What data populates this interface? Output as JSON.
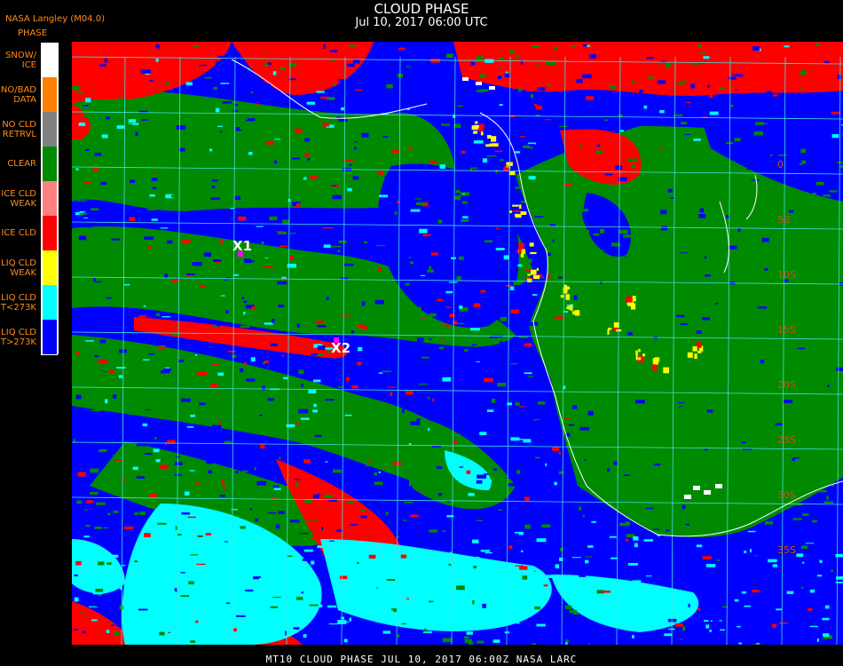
{
  "header": {
    "title": "CLOUD PHASE",
    "subtitle": "Jul 10, 2017 06:00 UTC",
    "producer": "NASA Langley (M04.0)",
    "legend_heading": "PHASE"
  },
  "legend": [
    {
      "lines": [
        "SNOW/",
        "ICE"
      ],
      "color": "#ffffff"
    },
    {
      "lines": [
        "NO/BAD",
        "DATA"
      ],
      "color": "#ff7f00"
    },
    {
      "lines": [
        "NO CLD",
        "RETRVL"
      ],
      "color": "#808080"
    },
    {
      "lines": [
        "CLEAR"
      ],
      "color": "#008a00"
    },
    {
      "lines": [
        "ICE CLD",
        "WEAK"
      ],
      "color": "#ff8080"
    },
    {
      "lines": [
        "ICE CLD"
      ],
      "color": "#ff0000"
    },
    {
      "lines": [
        "LIQ CLD",
        "WEAK"
      ],
      "color": "#ffff00"
    },
    {
      "lines": [
        "LIQ CLD",
        "T<273K"
      ],
      "color": "#00ffff"
    },
    {
      "lines": [
        "LIQ CLD",
        "T>273K"
      ],
      "color": "#0000ff"
    }
  ],
  "map": {
    "markers": [
      {
        "label": "X1",
        "color": "#ff00ff"
      },
      {
        "label": "X2",
        "color": "#ff00ff"
      }
    ],
    "lat_labels": [
      "0",
      "5S",
      "10S",
      "15S",
      "20S",
      "25S",
      "30S",
      "35S"
    ],
    "grid_color": "#40e0e0",
    "coast_color": "#ffffff"
  },
  "footer": {
    "text": "MT10  CLOUD PHASE   JUL 10, 2017 06:00Z   NASA LARC"
  }
}
